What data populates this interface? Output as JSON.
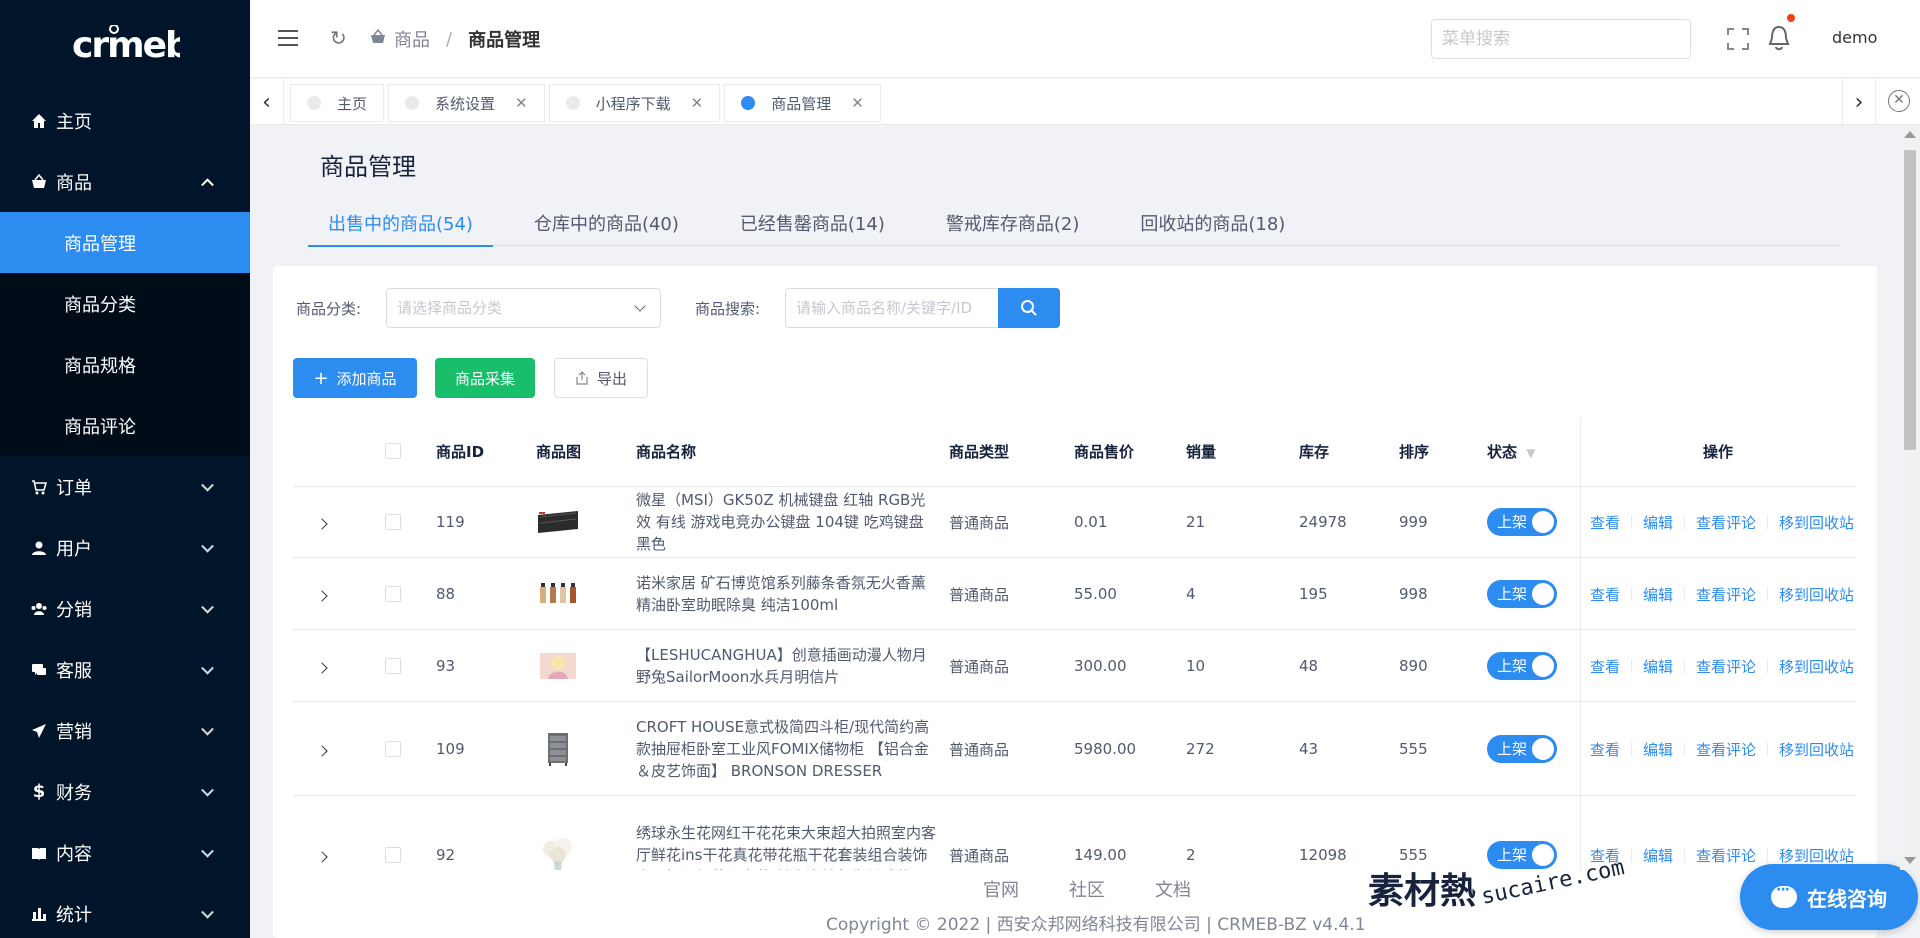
{
  "logo": "crmeb",
  "sidebar": {
    "items": [
      {
        "label": "主页",
        "icon": "home-icon"
      },
      {
        "label": "商品",
        "icon": "basket-icon",
        "expanded": true,
        "children": [
          {
            "label": "商品管理",
            "active": true
          },
          {
            "label": "商品分类"
          },
          {
            "label": "商品规格"
          },
          {
            "label": "商品评论"
          }
        ]
      },
      {
        "label": "订单",
        "icon": "cart-icon"
      },
      {
        "label": "用户",
        "icon": "user-icon"
      },
      {
        "label": "分销",
        "icon": "group-icon"
      },
      {
        "label": "客服",
        "icon": "chat-icon"
      },
      {
        "label": "营销",
        "icon": "send-icon"
      },
      {
        "label": "财务",
        "icon": "dollar-icon"
      },
      {
        "label": "内容",
        "icon": "book-icon"
      },
      {
        "label": "统计",
        "icon": "bar-chart-icon"
      }
    ]
  },
  "header": {
    "breadcrumb": {
      "parent": "商品",
      "separator": "/",
      "current": "商品管理"
    },
    "menu_search_placeholder": "菜单搜索",
    "user": "demo"
  },
  "tabs": [
    {
      "label": "主页",
      "closable": false,
      "active": false
    },
    {
      "label": "系统设置",
      "closable": true,
      "active": false
    },
    {
      "label": "小程序下载",
      "closable": true,
      "active": false
    },
    {
      "label": "商品管理",
      "closable": true,
      "active": true
    }
  ],
  "page": {
    "title": "商品管理",
    "tabs": [
      "出售中的商品(54)",
      "仓库中的商品(40)",
      "已经售罄商品(14)",
      "警戒库存商品(2)",
      "回收站的商品(18)"
    ],
    "filters": {
      "category_label": "商品分类:",
      "category_placeholder": "请选择商品分类",
      "search_label": "商品搜索:",
      "search_placeholder": "请输入商品名称/关键字/ID"
    },
    "buttons": {
      "add": "添加商品",
      "collect": "商品采集",
      "export": "导出"
    }
  },
  "table": {
    "headers": {
      "id": "商品ID",
      "image": "商品图",
      "name": "商品名称",
      "type": "商品类型",
      "price": "商品售价",
      "sales": "销量",
      "stock": "库存",
      "sort": "排序",
      "status": "状态",
      "ops": "操作"
    },
    "rows": [
      {
        "id": "119",
        "name": "微星（MSI）GK50Z 机械键盘 红轴 RGB光效 有线 游戏电竞办公键盘 104键 吃鸡键盘 黑色",
        "type": "普通商品",
        "price": "0.01",
        "sales": "21",
        "stock": "24978",
        "sort": "999",
        "status": "上架"
      },
      {
        "id": "88",
        "name": "诺米家居 矿石博览馆系列藤条香氛无火香薰精油卧室助眠除臭 纯洁100ml",
        "type": "普通商品",
        "price": "55.00",
        "sales": "4",
        "stock": "195",
        "sort": "998",
        "status": "上架"
      },
      {
        "id": "93",
        "name": "【LESHUCANGHUA】创意插画动漫人物月野兔SailorMoon水兵月明信片",
        "type": "普通商品",
        "price": "300.00",
        "sales": "10",
        "stock": "48",
        "sort": "890",
        "status": "上架"
      },
      {
        "id": "109",
        "name": "CROFT HOUSE意式极简四斗柜/现代简约高款抽屉柜卧室工业风FOMIX储物柜 【铝合金＆皮艺饰面】 BRONSON DRESSER",
        "type": "普通商品",
        "price": "5980.00",
        "sales": "272",
        "stock": "43",
        "sort": "555",
        "status": "上架"
      },
      {
        "id": "92",
        "name": "绣球永生花网红干花花束大束超大拍照室内客厅鲜花ins干花真花带花瓶干花套装组合装饰家居摆设加花瓶套装 单支浅兰永生绣球花",
        "type": "普通商品",
        "price": "149.00",
        "sales": "2",
        "stock": "12098",
        "sort": "555",
        "status": "上架"
      }
    ],
    "ops": [
      "查看",
      "编辑",
      "查看评论",
      "移到回收站"
    ]
  },
  "footer": {
    "links": [
      "官网",
      "社区",
      "文档"
    ],
    "copyright": "Copyright © 2022 | 西安众邦网络科技有限公司 | CRMEB-BZ v4.4.1"
  },
  "watermark": {
    "main": "素材熱",
    "sub": "sucaire.com"
  },
  "chat_button": "在线咨询",
  "colors": {
    "primary": "#2d8cf0",
    "success": "#19be6b",
    "sidebar": "#001529"
  }
}
